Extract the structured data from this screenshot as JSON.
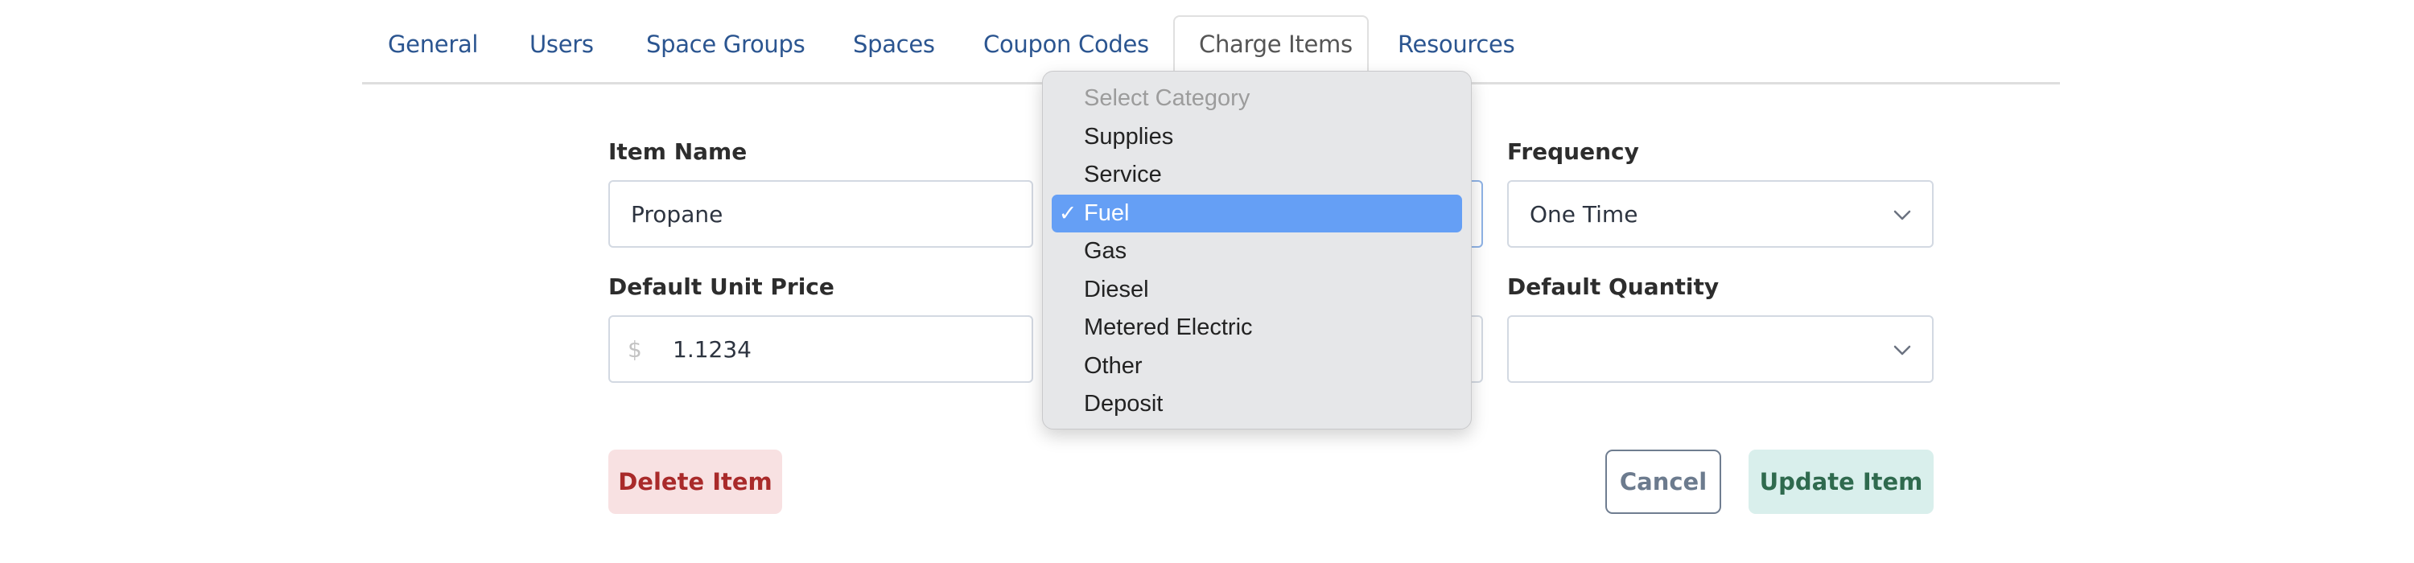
{
  "tabs": [
    {
      "label": "General",
      "active": false
    },
    {
      "label": "Users",
      "active": false
    },
    {
      "label": "Space Groups",
      "active": false
    },
    {
      "label": "Spaces",
      "active": false
    },
    {
      "label": "Coupon Codes",
      "active": false
    },
    {
      "label": "Charge Items",
      "active": true
    },
    {
      "label": "Resources",
      "active": false
    }
  ],
  "form": {
    "item_name": {
      "label": "Item Name",
      "value": "Propane"
    },
    "frequency": {
      "label": "Frequency",
      "value": "One Time"
    },
    "default_unit_price": {
      "label": "Default Unit Price",
      "prefix": "$",
      "value": "1.1234"
    },
    "default_quantity": {
      "label": "Default Quantity",
      "value": ""
    }
  },
  "category_dropdown": {
    "options": [
      {
        "label": "Select Category",
        "disabled": true,
        "selected": false
      },
      {
        "label": "Supplies",
        "disabled": false,
        "selected": false
      },
      {
        "label": "Service",
        "disabled": false,
        "selected": false
      },
      {
        "label": "Fuel",
        "disabled": false,
        "selected": true
      },
      {
        "label": "Gas",
        "disabled": false,
        "selected": false
      },
      {
        "label": "Diesel",
        "disabled": false,
        "selected": false
      },
      {
        "label": "Metered Electric",
        "disabled": false,
        "selected": false
      },
      {
        "label": "Other",
        "disabled": false,
        "selected": false
      },
      {
        "label": "Deposit",
        "disabled": false,
        "selected": false
      }
    ],
    "check_glyph": "✓"
  },
  "buttons": {
    "delete": "Delete Item",
    "cancel": "Cancel",
    "update": "Update Item"
  },
  "colors": {
    "tab_link": "#2b5590",
    "selected_option": "#659ff5",
    "delete_text": "#a92a2a",
    "update_text": "#2f6a4e"
  }
}
